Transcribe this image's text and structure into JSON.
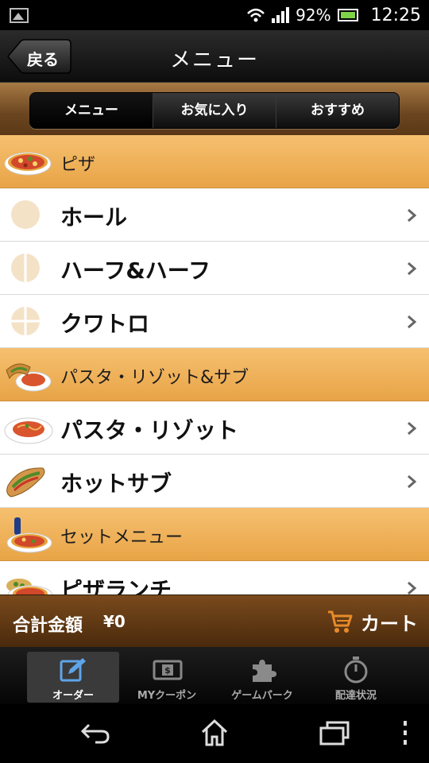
{
  "status_bar": {
    "battery": "92%",
    "time": "12:25"
  },
  "header": {
    "back_label": "戻る",
    "title": "メニュー"
  },
  "segments": [
    "メニュー",
    "お気に入り",
    "おすすめ"
  ],
  "menu": {
    "sections": [
      {
        "label": "ピザ",
        "items": [
          "ホール",
          "ハーフ&ハーフ",
          "クワトロ"
        ]
      },
      {
        "label": "パスタ・リゾット&サブ",
        "items": [
          "パスタ・リゾット",
          "ホットサブ"
        ]
      },
      {
        "label": "セットメニュー",
        "items": [
          "ピザランチ"
        ]
      }
    ]
  },
  "footer": {
    "total_label": "合計金額",
    "total_amount": "¥0",
    "cart_label": "カート"
  },
  "tabs": [
    {
      "label": "オーダー",
      "icon": "edit-icon",
      "active": true
    },
    {
      "label": "MYクーポン",
      "icon": "coupon-icon",
      "active": false
    },
    {
      "label": "ゲームパーク",
      "icon": "puzzle-icon",
      "active": false
    },
    {
      "label": "配達状況",
      "icon": "stopwatch-icon",
      "active": false
    }
  ],
  "colors": {
    "section_orange": "#eeb15c",
    "header_brown": "#6b4520",
    "total_brown": "#5e3812"
  }
}
